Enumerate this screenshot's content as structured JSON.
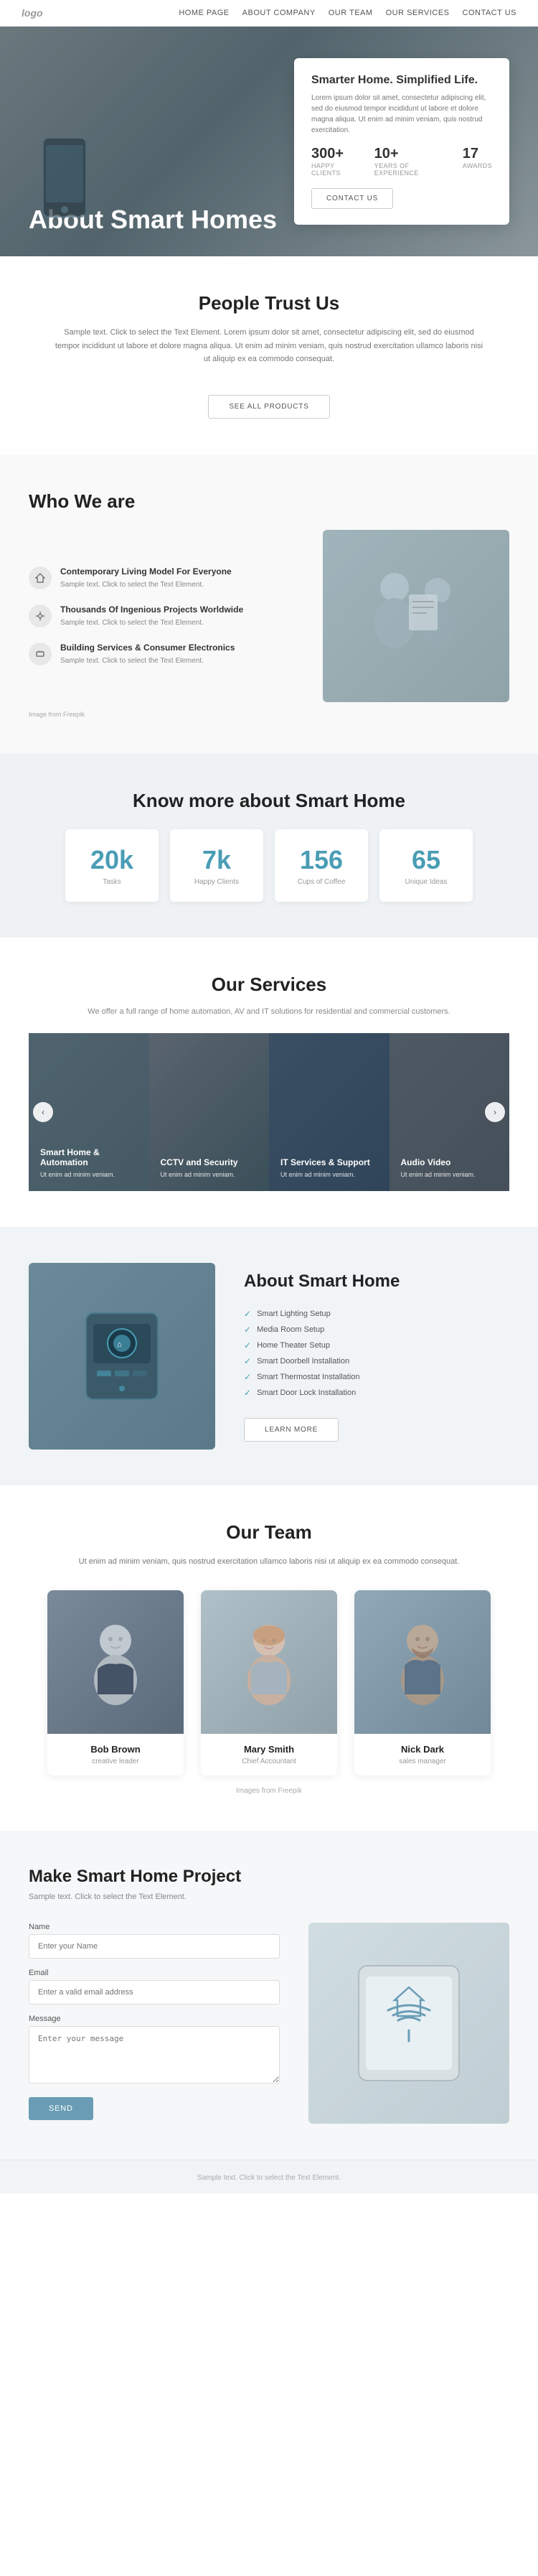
{
  "nav": {
    "logo": "logo",
    "links": [
      "Home Page",
      "About Company",
      "Our Team",
      "Our Services",
      "Contact Us"
    ]
  },
  "hero": {
    "title": "About Smart Homes",
    "card": {
      "title": "Smarter Home. Simplified Life.",
      "text": "Lorem ipsum dolor sit amet, consectetur adipiscing elit, sed do eiusmod tempor incididunt ut labore et dolore magna aliqua. Ut enim ad minim veniam, quis nostrud exercitation.",
      "stats": [
        {
          "num": "300+",
          "label": "HAPPY CLIENTS"
        },
        {
          "num": "10+",
          "label": "YEARS OF EXPERIENCE"
        },
        {
          "num": "17",
          "label": "AWARDS"
        }
      ],
      "btn": "CONTACT US"
    }
  },
  "trust": {
    "title": "People Trust Us",
    "text": "Sample text. Click to select the Text Element. Lorem ipsum dolor sit amet, consectetur adipiscing elit, sed do eiusmod tempor incididunt ut labore et dolore magna aliqua. Ut enim ad minim veniam, quis nostrud exercitation ullamco laboris nisi ut aliquip ex ea commodo consequat.",
    "btn": "SEE ALL PRODUCTS"
  },
  "who": {
    "title": "Who We are",
    "items": [
      {
        "icon": "1",
        "title": "Contemporary Living Model For Everyone",
        "text": "Sample text. Click to select the Text Element."
      },
      {
        "icon": "2",
        "title": "Thousands Of Ingenious Projects Worldwide",
        "text": "Sample text. Click to select the Text Element."
      },
      {
        "icon": "3",
        "title": "Building Services & Consumer Electronics",
        "text": "Sample text. Click to select the Text Element."
      }
    ],
    "credit": "Image from Freepik"
  },
  "stats": {
    "title": "Know more about Smart Home",
    "items": [
      {
        "num": "20k",
        "label": "Tasks"
      },
      {
        "num": "7k",
        "label": "Happy Clients"
      },
      {
        "num": "156",
        "label": "Cups of Coffee"
      },
      {
        "num": "65",
        "label": "Unique Ideas"
      }
    ]
  },
  "services": {
    "title": "Our Services",
    "subtitle": "We offer a full range of home automation, AV and IT solutions for residential and commercial customers.",
    "items": [
      {
        "name": "Smart Home & Automation",
        "desc": "Ut enim ad minim veniam."
      },
      {
        "name": "CCTV and Security",
        "desc": "Ut enim ad minim veniam."
      },
      {
        "name": "IT Services & Support",
        "desc": "Ut enim ad minim veniam."
      },
      {
        "name": "Audio Video",
        "desc": "Ut enim ad minim veniam."
      }
    ]
  },
  "about": {
    "title": "About Smart Home",
    "list": [
      "Smart Lighting Setup",
      "Media Room Setup",
      "Home Theater Setup",
      "Smart Doorbell Installation",
      "Smart Thermostat Installation",
      "Smart Door Lock Installation"
    ],
    "btn": "LEARN MORE"
  },
  "team": {
    "title": "Our Team",
    "subtitle": "Ut enim ad minim veniam, quis nostrud exercitation ullamco laboris nisi ut aliquip ex ea commodo consequat.",
    "members": [
      {
        "name": "Bob Brown",
        "role": "creative leader"
      },
      {
        "name": "Mary Smith",
        "role": "Chief Accountant"
      },
      {
        "name": "Nick Dark",
        "role": "sales manager"
      }
    ],
    "credit": "Images from Freepik"
  },
  "contact": {
    "title": "Make Smart Home Project",
    "subtitle": "Sample text. Click to select the Text Element.",
    "form": {
      "name_label": "Name",
      "name_placeholder": "Enter your Name",
      "email_label": "Email",
      "email_placeholder": "Enter a valid email address",
      "message_label": "Message",
      "message_placeholder": "Enter your message",
      "btn": "SEND"
    }
  },
  "footer": {
    "text": "Sample text. Click to select the Text Element."
  }
}
